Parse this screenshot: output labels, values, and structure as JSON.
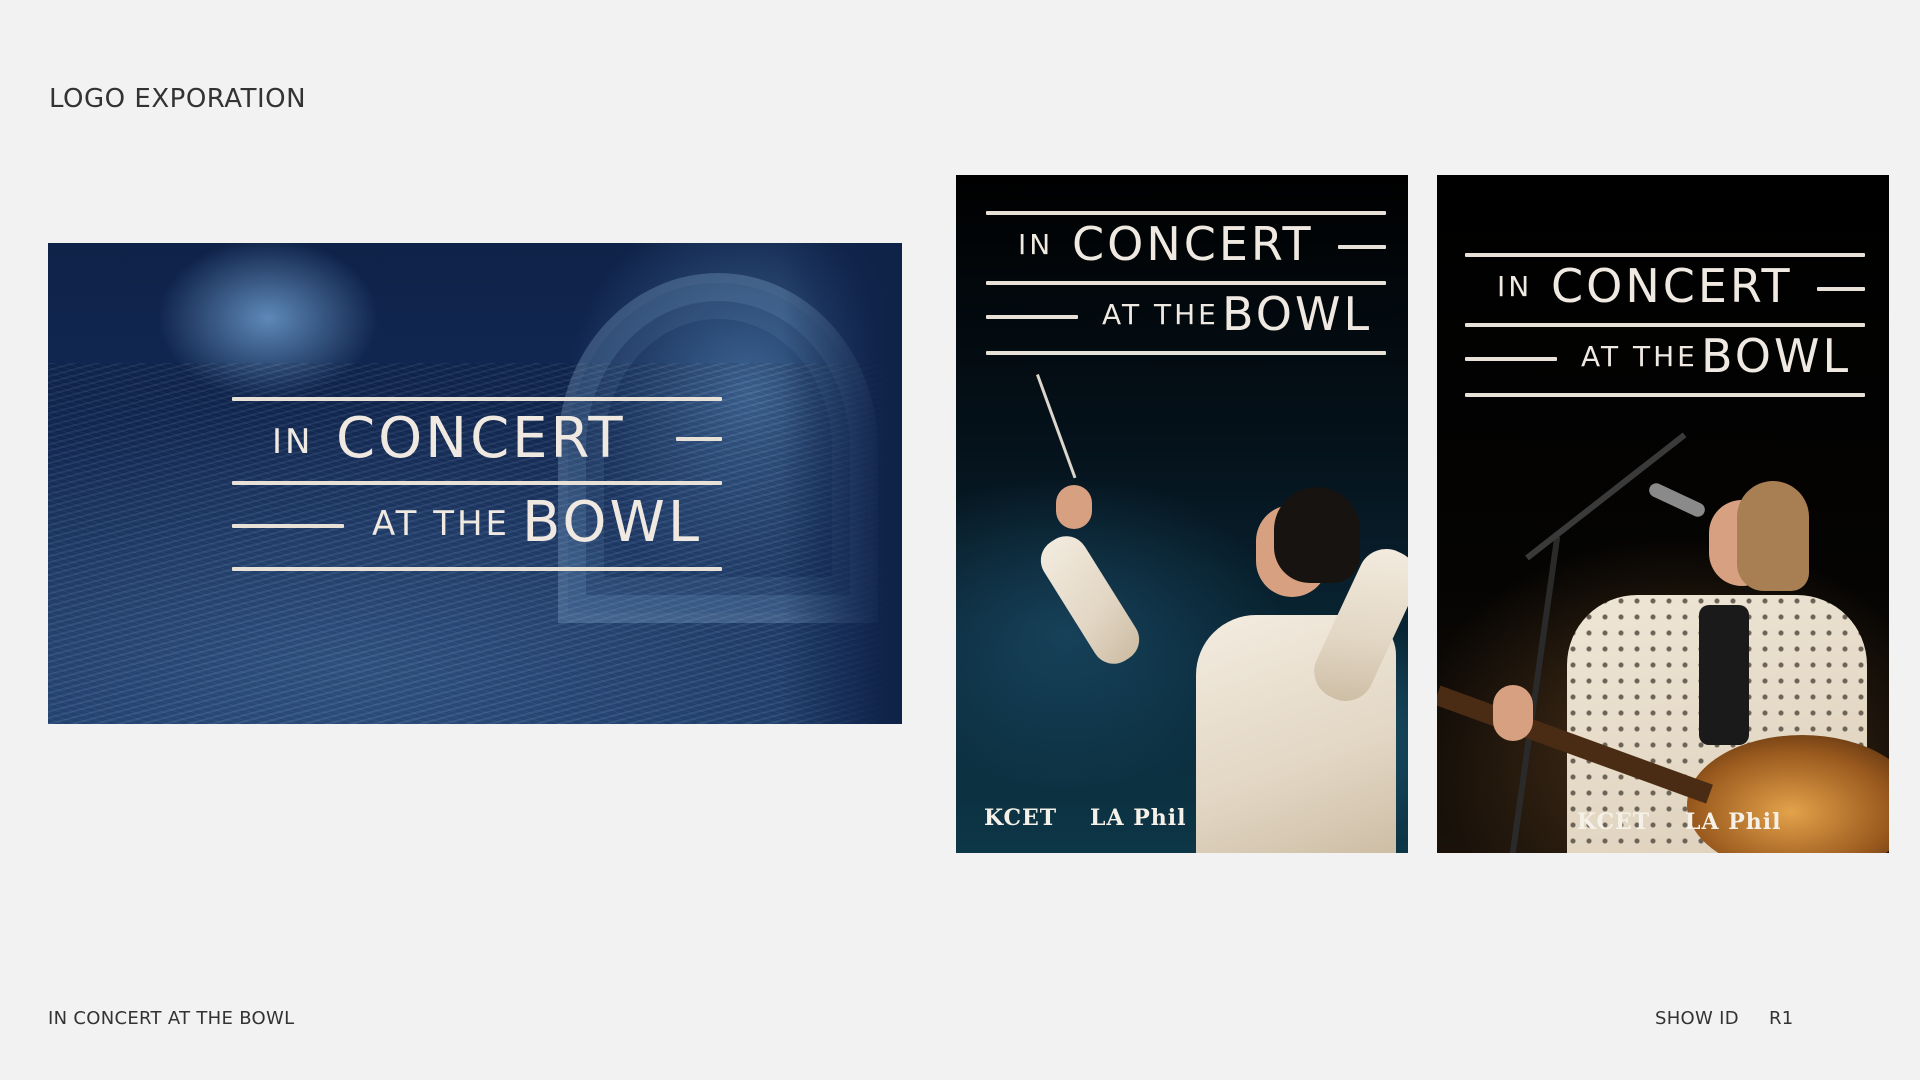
{
  "page": {
    "heading": "LOGO EXPORATION",
    "footer_title": "IN CONCERT AT THE BOWL",
    "footer_section": "SHOW ID",
    "footer_revision": "R1"
  },
  "logo": {
    "word_in": "IN",
    "word_concert": "CONCERT",
    "word_at_the": "AT THE",
    "word_bowl": "BOWL"
  },
  "sponsors": {
    "kcet": "KCET",
    "laphil": "LA Phil"
  },
  "colors": {
    "background": "#f2f2f2",
    "navy": "#0f2248",
    "logo_cream": "#efe9e1"
  }
}
